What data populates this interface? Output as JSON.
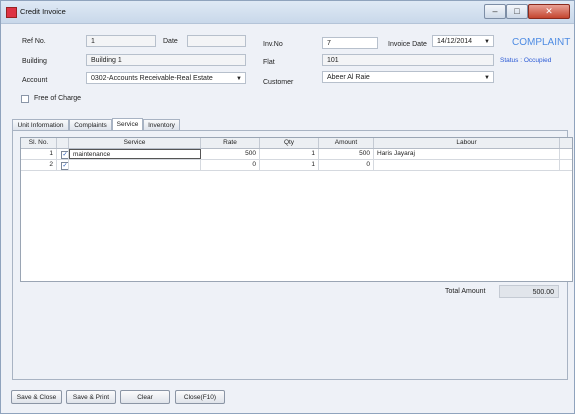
{
  "window": {
    "title": "Credit Invoice",
    "min": "–",
    "max": "□",
    "close": "✕"
  },
  "form": {
    "ref_no_label": "Ref No.",
    "ref_no": "1",
    "date_label": "Date",
    "date": "",
    "building_label": "Building",
    "building": "Building 1",
    "account_label": "Account",
    "account": "0302-Accounts Receivable-Real Estate",
    "free_of_charge_label": "Free of Charge",
    "free_of_charge": false,
    "inv_no_label": "Inv.No",
    "inv_no": "7",
    "invoice_date_label": "Invoice Date",
    "invoice_date": "14/12/2014",
    "flat_label": "Flat",
    "flat": "101",
    "customer_label": "Customer",
    "customer": "Abeer Al Raie",
    "complaint_text": "COMPLAINT",
    "status_text": "Status : Occupied"
  },
  "tabs": [
    {
      "label": "Unit Information",
      "active": false
    },
    {
      "label": "Complaints",
      "active": false
    },
    {
      "label": "Service",
      "active": true
    },
    {
      "label": "Inventory",
      "active": false
    }
  ],
  "grid": {
    "columns": [
      "Sl. No.",
      "",
      "Service",
      "Rate",
      "Qty",
      "Amount",
      "Labour"
    ],
    "rows": [
      {
        "sl": "1",
        "checked": true,
        "service": "maintenance",
        "rate": "500",
        "qty": "1",
        "amount": "500",
        "labour": "Haris Jayaraj"
      },
      {
        "sl": "2",
        "checked": true,
        "service": "",
        "rate": "0",
        "qty": "1",
        "amount": "0",
        "labour": ""
      }
    ]
  },
  "totals": {
    "label": "Total Amount",
    "value": "500.00"
  },
  "buttons": {
    "save_close": "Save & Close",
    "save_print": "Save & Print",
    "clear": "Clear",
    "close": "Close(F10)"
  },
  "icons": {
    "dropdown": "▼",
    "check": "✓"
  },
  "colors": {
    "complaint": "#4d8be3",
    "status": "#2b5ad6"
  }
}
